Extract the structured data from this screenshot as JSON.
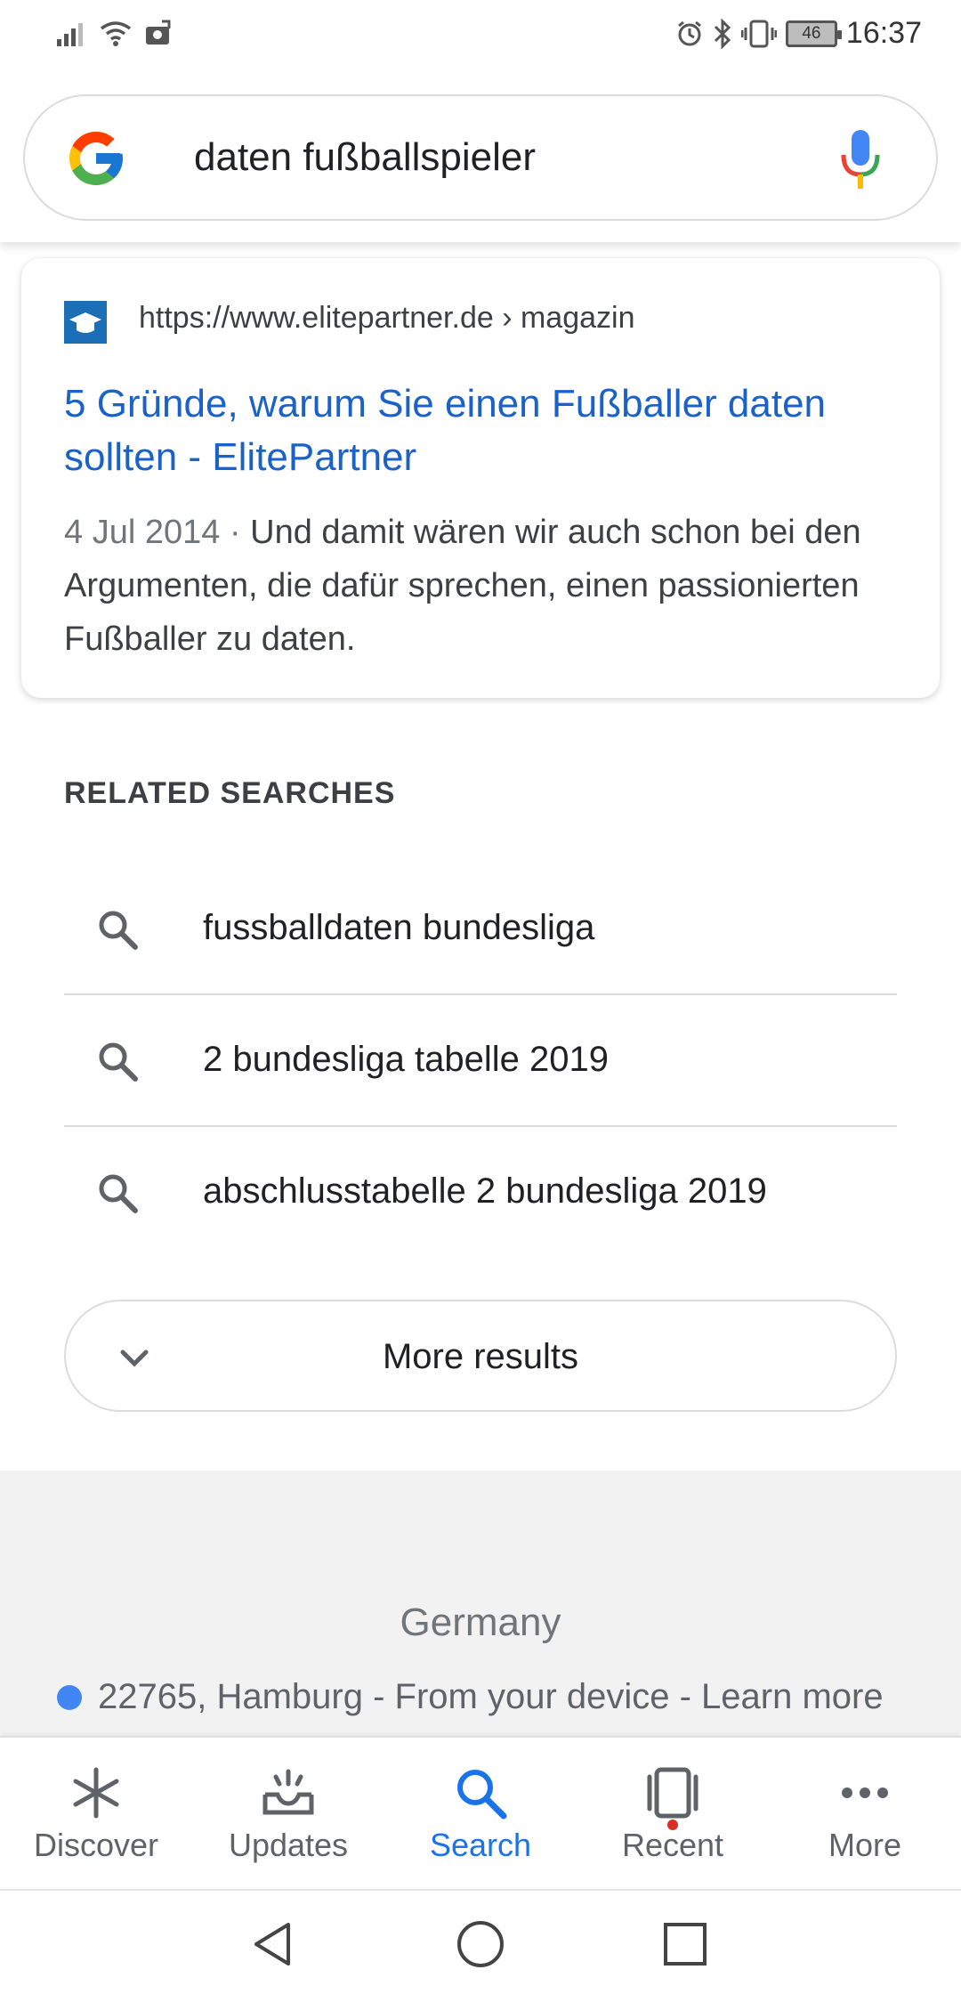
{
  "status_bar": {
    "time": "16:37",
    "battery": "46"
  },
  "search": {
    "query": "daten fußballspieler"
  },
  "result": {
    "url": "https://www.elitepartner.de › magazin",
    "title": "5 Gründe, warum Sie einen Fußballer daten sollten - ElitePartner",
    "date": "4 Jul 2014 · ",
    "snippet": "Und damit wären wir auch schon bei den Argumenten, die dafür sprechen, einen passionierten Fußballer zu daten."
  },
  "related": {
    "heading": "RELATED SEARCHES",
    "items": [
      {
        "label": "fussballdaten bundesliga"
      },
      {
        "label": "2 bundesliga tabelle 2019"
      },
      {
        "label": "abschlusstabelle 2 bundesliga 2019"
      }
    ],
    "more_label": "More results"
  },
  "footer": {
    "country": "Germany",
    "location": "22765, Hamburg - From your device - Learn more"
  },
  "bottom_nav": {
    "items": [
      {
        "label": "Discover",
        "icon": "asterisk-icon"
      },
      {
        "label": "Updates",
        "icon": "inbox-icon"
      },
      {
        "label": "Search",
        "icon": "search-icon"
      },
      {
        "label": "Recent",
        "icon": "recent-icon"
      },
      {
        "label": "More",
        "icon": "more-dots-icon"
      }
    ],
    "active": "Search"
  },
  "colors": {
    "link_blue": "#1a62c7",
    "active_blue": "#1a73e8",
    "location_dot": "#4285f4"
  }
}
